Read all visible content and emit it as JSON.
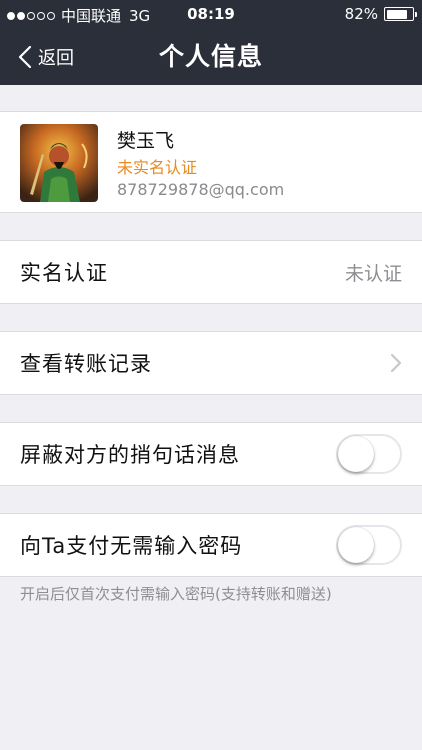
{
  "status_bar": {
    "carrier": "中国联通",
    "network": "3G",
    "time": "08:19",
    "battery": "82%",
    "battery_level": 0.82,
    "signal_bars_filled": 2,
    "signal_bars_total": 5
  },
  "nav": {
    "back_label": "返回",
    "title": "个人信息"
  },
  "profile": {
    "name": "樊玉飞",
    "verification_status": "未实名认证",
    "email": "878729878@qq.com",
    "status_color": "#e78a1f"
  },
  "rows": {
    "realname_label": "实名认证",
    "realname_value": "未认证",
    "transfer_records_label": "查看转账记录",
    "block_messages_label": "屏蔽对方的捎句话消息",
    "block_messages_on": false,
    "no_password_label": "向Ta支付无需输入密码",
    "no_password_on": false
  },
  "footnote": "开启后仅首次支付需输入密码(支持转账和赠送)",
  "colors": {
    "nav_background": "#2b2f3a",
    "page_background": "#efeff4"
  }
}
